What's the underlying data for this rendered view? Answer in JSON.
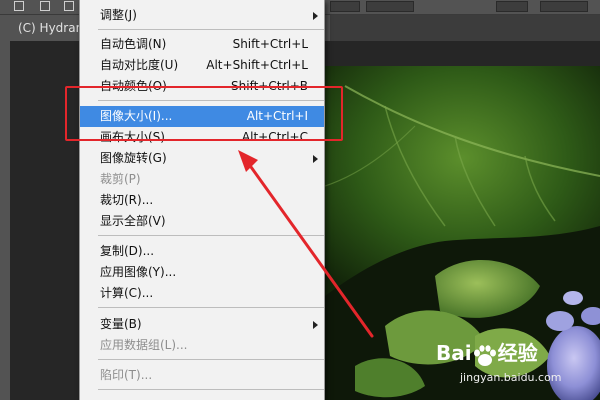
{
  "tab": {
    "title": "(C) Hydrang"
  },
  "menu": {
    "items": [
      {
        "label": "调整(J)",
        "shortcut": "",
        "submenu": true,
        "disabled": false
      },
      {
        "label": "自动色调(N)",
        "shortcut": "Shift+Ctrl+L",
        "submenu": false,
        "disabled": false
      },
      {
        "label": "自动对比度(U)",
        "shortcut": "Alt+Shift+Ctrl+L",
        "submenu": false,
        "disabled": false
      },
      {
        "label": "自动颜色(O)",
        "shortcut": "Shift+Ctrl+B",
        "submenu": false,
        "disabled": false
      },
      {
        "label": "图像大小(I)...",
        "shortcut": "Alt+Ctrl+I",
        "submenu": false,
        "disabled": false,
        "highlighted": true
      },
      {
        "label": "画布大小(S)...",
        "shortcut": "Alt+Ctrl+C",
        "submenu": false,
        "disabled": false
      },
      {
        "label": "图像旋转(G)",
        "shortcut": "",
        "submenu": true,
        "disabled": false
      },
      {
        "label": "裁剪(P)",
        "shortcut": "",
        "submenu": false,
        "disabled": true
      },
      {
        "label": "裁切(R)...",
        "shortcut": "",
        "submenu": false,
        "disabled": false
      },
      {
        "label": "显示全部(V)",
        "shortcut": "",
        "submenu": false,
        "disabled": false
      },
      {
        "label": "复制(D)...",
        "shortcut": "",
        "submenu": false,
        "disabled": false
      },
      {
        "label": "应用图像(Y)...",
        "shortcut": "",
        "submenu": false,
        "disabled": false
      },
      {
        "label": "计算(C)...",
        "shortcut": "",
        "submenu": false,
        "disabled": false
      },
      {
        "label": "变量(B)",
        "shortcut": "",
        "submenu": true,
        "disabled": false
      },
      {
        "label": "应用数据组(L)...",
        "shortcut": "",
        "submenu": false,
        "disabled": true
      },
      {
        "label": "陷印(T)...",
        "shortcut": "",
        "submenu": false,
        "disabled": true
      }
    ]
  },
  "colors": {
    "highlight": "#3f8ae3",
    "annotation": "#e3262b",
    "menu_bg": "#f2f2f2"
  },
  "watermark": {
    "brand_left": "Bai",
    "brand_right": "经验",
    "url": "jingyan.baidu.com"
  }
}
